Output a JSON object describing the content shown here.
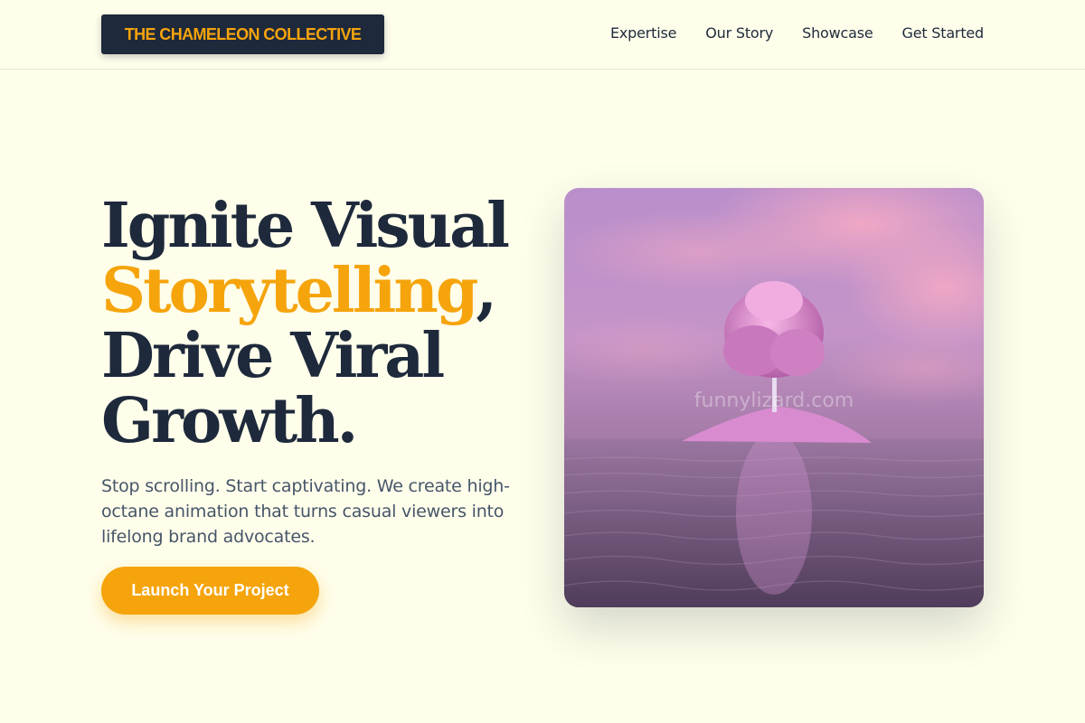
{
  "brand": {
    "logo_text": "THE CHAMELEON COLLECTIVE"
  },
  "nav": {
    "items": [
      {
        "label": "Expertise"
      },
      {
        "label": "Our Story"
      },
      {
        "label": "Showcase"
      },
      {
        "label": "Get Started"
      }
    ]
  },
  "hero": {
    "headline_line1": "Ignite Visual",
    "headline_accent": "Storytelling",
    "headline_comma": ",",
    "headline_line3": "Drive Viral",
    "headline_line4": "Growth.",
    "subtext": "Stop scrolling. Start captivating. We create high-octane animation that turns casual viewers into lifelong brand advocates.",
    "cta_label": "Launch Your Project",
    "image_watermark": "funnylizard.com"
  },
  "colors": {
    "background": "#fefeeb",
    "navy": "#1e293b",
    "accent": "#f5a40c",
    "body_text": "#475569"
  }
}
